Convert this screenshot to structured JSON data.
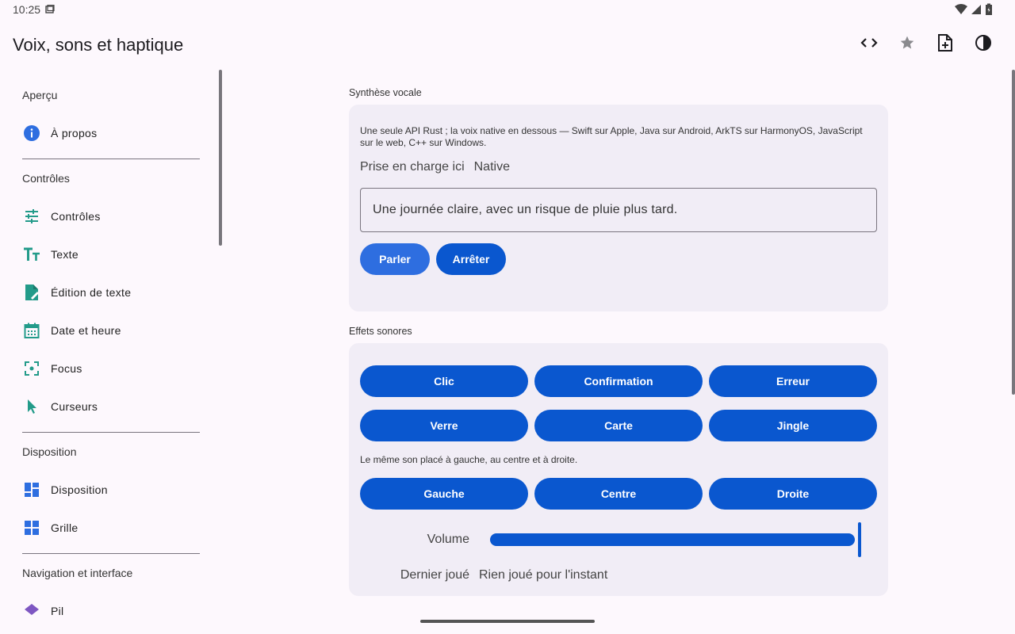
{
  "status": {
    "time": "10:25"
  },
  "appbar": {
    "title": "Voix, sons et haptique"
  },
  "sidebar": {
    "sections": {
      "apercu": "Aperçu",
      "controles": "Contrôles",
      "disposition": "Disposition",
      "navigation": "Navigation et interface"
    },
    "items": {
      "a_propos": "À propos",
      "controles": "Contrôles",
      "texte": "Texte",
      "edition": "Édition de texte",
      "date": "Date et heure",
      "focus": "Focus",
      "curseurs": "Curseurs",
      "disposition": "Disposition",
      "grille": "Grille",
      "partial": "Pil"
    }
  },
  "tts": {
    "section_title": "Synthèse vocale",
    "description": "Une seule API Rust ; la voix native en dessous — Swift sur Apple, Java sur Android, ArkTS sur HarmonyOS, JavaScript sur le web, C++ sur Windows.",
    "support_label": "Prise en charge ici",
    "support_value": "Native",
    "input_value": "Une journée claire, avec un risque de pluie plus tard.",
    "speak": "Parler",
    "stop": "Arrêter"
  },
  "sfx": {
    "section_title": "Effets sonores",
    "buttons": [
      "Clic",
      "Confirmation",
      "Erreur",
      "Verre",
      "Carte",
      "Jingle"
    ],
    "pan_description": "Le même son placé à gauche, au centre et à droite.",
    "pan_buttons": [
      "Gauche",
      "Centre",
      "Droite"
    ],
    "volume_label": "Volume",
    "volume_value": 1.0,
    "last_label": "Dernier joué",
    "last_value": "Rien joué pour l'instant"
  },
  "colors": {
    "accent": "#0a57cf",
    "icon_teal": "#239b8a",
    "icon_blue": "#2e6ee0"
  }
}
